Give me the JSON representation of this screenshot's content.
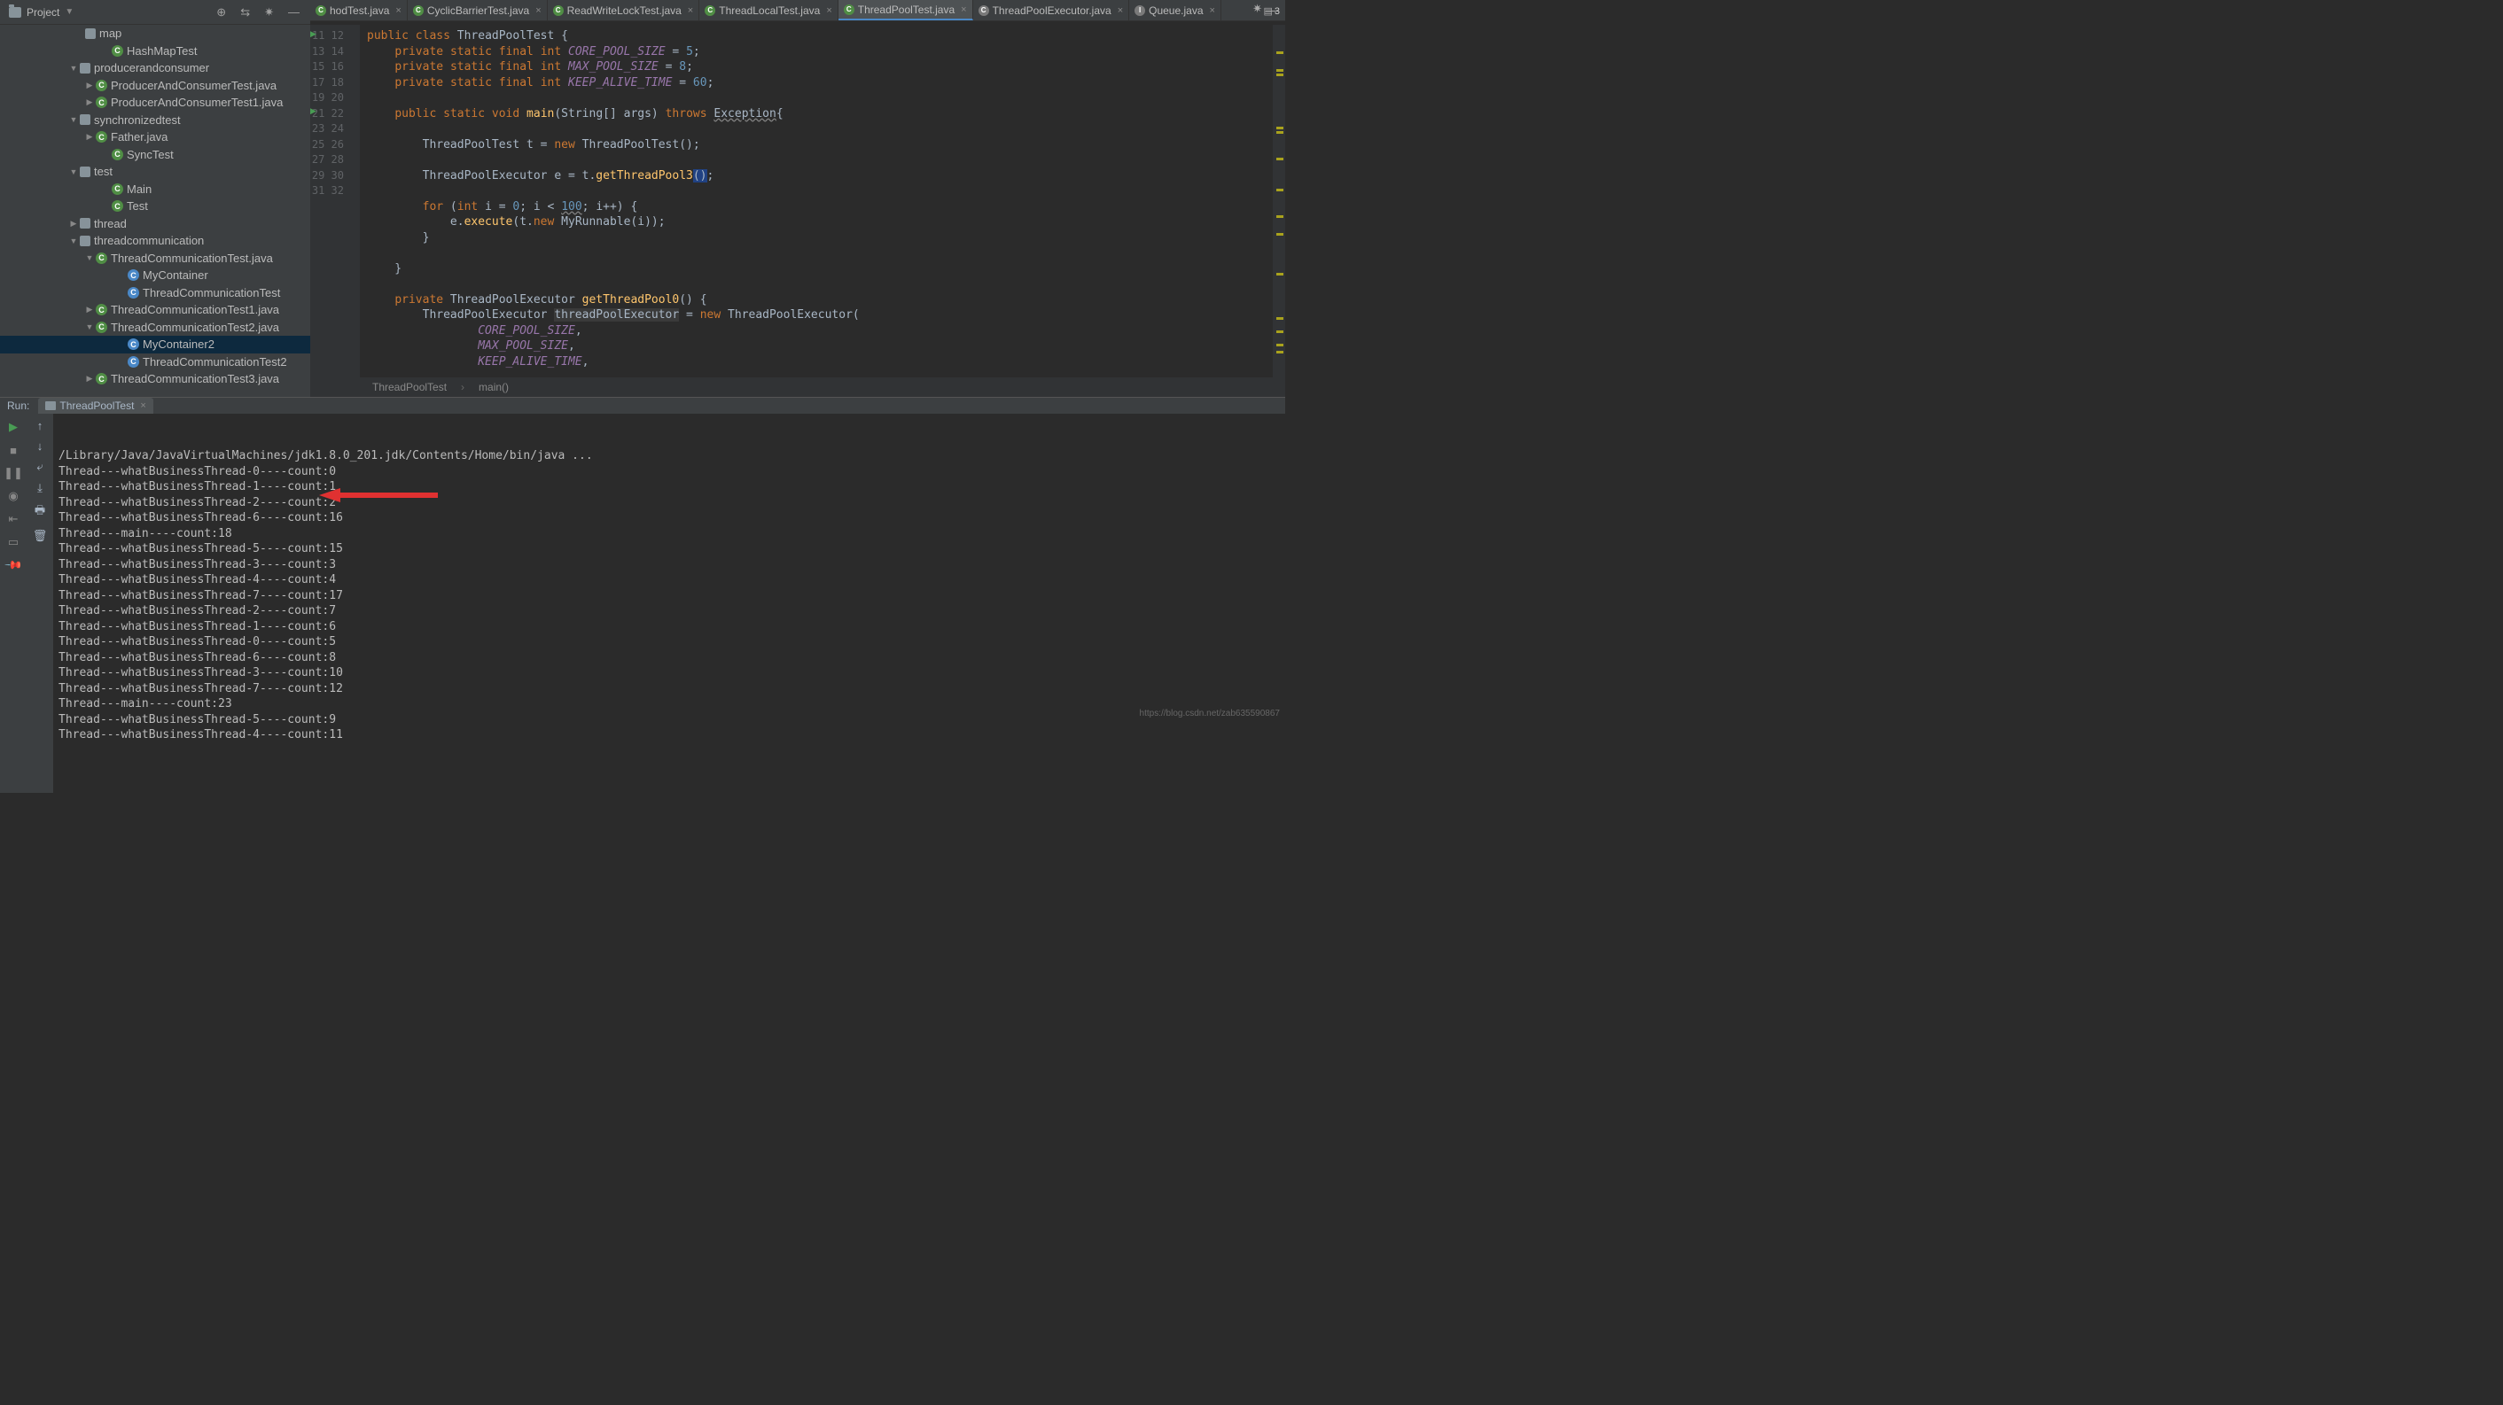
{
  "header": {
    "project_label": "Project",
    "notification_count": "3"
  },
  "tabs": [
    {
      "label": "hodTest.java",
      "icon": "C",
      "active": false,
      "iconcls": "cls"
    },
    {
      "label": "CyclicBarrierTest.java",
      "icon": "C",
      "active": false,
      "iconcls": "cls"
    },
    {
      "label": "ReadWriteLockTest.java",
      "icon": "C",
      "active": false,
      "iconcls": "cls"
    },
    {
      "label": "ThreadLocalTest.java",
      "icon": "C",
      "active": false,
      "iconcls": "cls"
    },
    {
      "label": "ThreadPoolTest.java",
      "icon": "C",
      "active": true,
      "iconcls": "cls"
    },
    {
      "label": "ThreadPoolExecutor.java",
      "icon": "C",
      "active": false,
      "iconcls": "iface"
    },
    {
      "label": "Queue.java",
      "icon": "I",
      "active": false,
      "iconcls": "iface"
    }
  ],
  "tree": [
    {
      "indent": 78,
      "arrow": "",
      "icon": "pkg",
      "label": "map"
    },
    {
      "indent": 108,
      "arrow": "",
      "icon": "cls",
      "label": "HashMapTest"
    },
    {
      "indent": 72,
      "arrow": "▼",
      "icon": "pkg",
      "label": "producerandconsumer"
    },
    {
      "indent": 90,
      "arrow": "▶",
      "icon": "cls",
      "label": "ProducerAndConsumerTest.java"
    },
    {
      "indent": 90,
      "arrow": "▶",
      "icon": "cls",
      "label": "ProducerAndConsumerTest1.java"
    },
    {
      "indent": 72,
      "arrow": "▼",
      "icon": "pkg",
      "label": "synchronizedtest"
    },
    {
      "indent": 90,
      "arrow": "▶",
      "icon": "cls",
      "label": "Father.java"
    },
    {
      "indent": 108,
      "arrow": "",
      "icon": "cls",
      "label": "SyncTest"
    },
    {
      "indent": 72,
      "arrow": "▼",
      "icon": "pkg",
      "label": "test"
    },
    {
      "indent": 108,
      "arrow": "",
      "icon": "cls",
      "label": "Main"
    },
    {
      "indent": 108,
      "arrow": "",
      "icon": "cls",
      "label": "Test"
    },
    {
      "indent": 72,
      "arrow": "▶",
      "icon": "pkg",
      "label": "thread"
    },
    {
      "indent": 72,
      "arrow": "▼",
      "icon": "pkg",
      "label": "threadcommunication"
    },
    {
      "indent": 90,
      "arrow": "▼",
      "icon": "cls",
      "label": "ThreadCommunicationTest.java"
    },
    {
      "indent": 126,
      "arrow": "",
      "icon": "inner",
      "label": "MyContainer"
    },
    {
      "indent": 126,
      "arrow": "",
      "icon": "inner",
      "label": "ThreadCommunicationTest"
    },
    {
      "indent": 90,
      "arrow": "▶",
      "icon": "cls",
      "label": "ThreadCommunicationTest1.java"
    },
    {
      "indent": 90,
      "arrow": "▼",
      "icon": "cls",
      "label": "ThreadCommunicationTest2.java"
    },
    {
      "indent": 126,
      "arrow": "",
      "icon": "inner",
      "label": "MyContainer2",
      "selected": true
    },
    {
      "indent": 126,
      "arrow": "",
      "icon": "inner",
      "label": "ThreadCommunicationTest2"
    },
    {
      "indent": 90,
      "arrow": "▶",
      "icon": "cls",
      "label": "ThreadCommunicationTest3.java"
    }
  ],
  "gutter_start": 11,
  "gutter_end": 32,
  "code_lines": [
    "public class ThreadPoolTest {",
    "    private static final int CORE_POOL_SIZE = 5;",
    "    private static final int MAX_POOL_SIZE = 8;",
    "    private static final int KEEP_ALIVE_TIME = 60;",
    "",
    "    public static void main(String[] args) throws Exception{",
    "",
    "        ThreadPoolTest t = new ThreadPoolTest();",
    "",
    "        ThreadPoolExecutor e = t.getThreadPool3();",
    "",
    "        for (int i = 0; i < 100; i++) {",
    "            e.execute(t.new MyRunnable(i));",
    "        }",
    "",
    "    }",
    "",
    "    private ThreadPoolExecutor getThreadPool0() {",
    "        ThreadPoolExecutor threadPoolExecutor = new ThreadPoolExecutor(",
    "                CORE_POOL_SIZE,",
    "                MAX_POOL_SIZE,",
    "                KEEP_ALIVE_TIME,"
  ],
  "breadcrumb": {
    "class": "ThreadPoolTest",
    "method": "main()"
  },
  "run": {
    "label": "Run:",
    "tab": "ThreadPoolTest",
    "lines": [
      "/Library/Java/JavaVirtualMachines/jdk1.8.0_201.jdk/Contents/Home/bin/java ...",
      "Thread---whatBusinessThread-0----count:0",
      "Thread---whatBusinessThread-1----count:1",
      "Thread---whatBusinessThread-2----count:2",
      "Thread---whatBusinessThread-6----count:16",
      "Thread---main----count:18",
      "Thread---whatBusinessThread-5----count:15",
      "Thread---whatBusinessThread-3----count:3",
      "Thread---whatBusinessThread-4----count:4",
      "Thread---whatBusinessThread-7----count:17",
      "Thread---whatBusinessThread-2----count:7",
      "Thread---whatBusinessThread-1----count:6",
      "Thread---whatBusinessThread-0----count:5",
      "Thread---whatBusinessThread-6----count:8",
      "Thread---whatBusinessThread-3----count:10",
      "Thread---whatBusinessThread-7----count:12",
      "Thread---main----count:23",
      "Thread---whatBusinessThread-5----count:9",
      "Thread---whatBusinessThread-4----count:11"
    ]
  },
  "watermark": "https://blog.csdn.net/zab635590867"
}
